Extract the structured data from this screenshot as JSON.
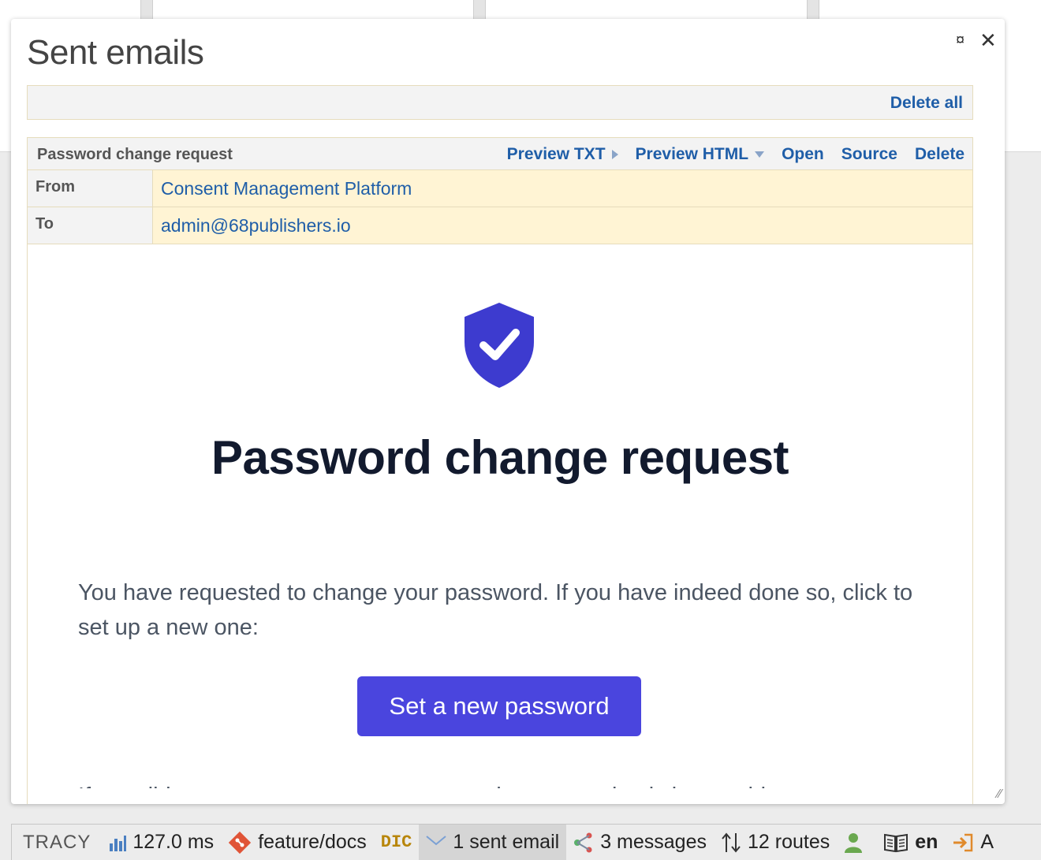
{
  "panel": {
    "title": "Sent emails",
    "maximize_icon": "maximize-icon",
    "close_icon": "close-icon",
    "delete_all_label": "Delete all"
  },
  "email": {
    "subject": "Password change request",
    "actions": {
      "preview_txt": "Preview TXT",
      "preview_html": "Preview HTML",
      "open": "Open",
      "source": "Source",
      "delete": "Delete"
    },
    "from_label": "From",
    "from_value": "Consent Management Platform",
    "to_label": "To",
    "to_value": "admin@68publishers.io",
    "body": {
      "icon": "shield-check-icon",
      "heading": "Password change request",
      "text": "You have requested to change your password. If you have indeed done so, click to set up a new one:",
      "button_label": "Set a new password",
      "text2": "If you did not want to reset your password, you can simply ignore this"
    }
  },
  "tracy_bar": {
    "logo": "TRACY",
    "time": "127.0 ms",
    "branch": "feature/docs",
    "dic": "DIC",
    "mail": "1 sent email",
    "messages": "3 messages",
    "routes": "12 routes",
    "lang": "en",
    "cut": "A"
  },
  "colors": {
    "accent": "#1f5ea8",
    "cta": "#4a45de",
    "shield": "#3d3bcf",
    "row_highlight": "#fff4d4",
    "border": "#e6dcbc"
  }
}
